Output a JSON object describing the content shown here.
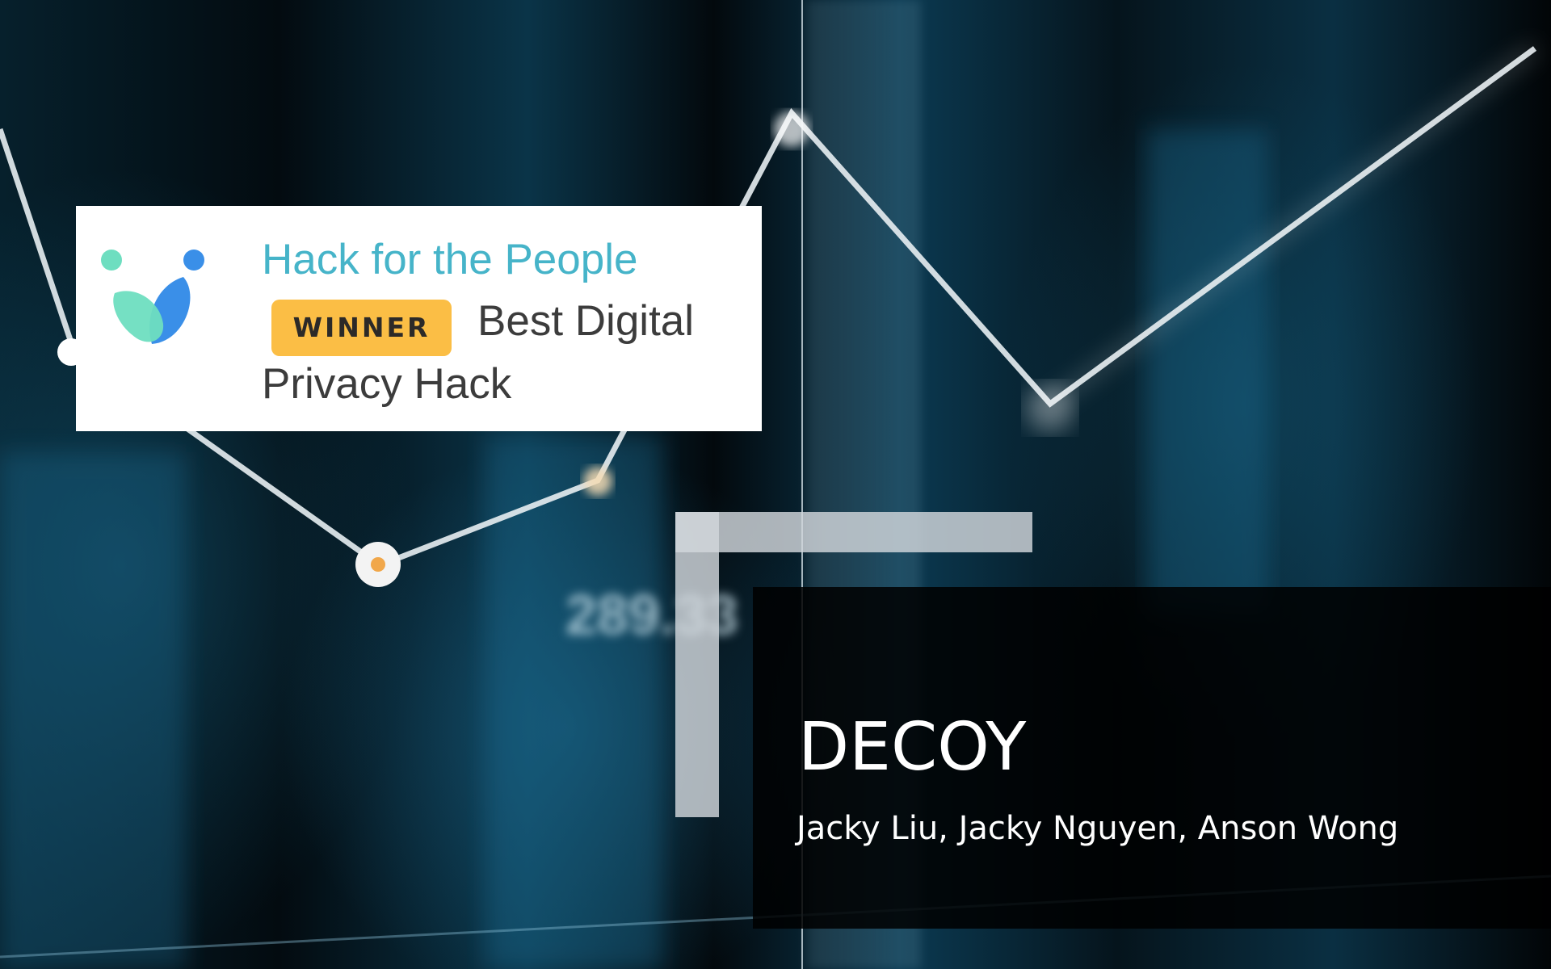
{
  "award": {
    "event": "Hack for the People",
    "badge": "WINNER",
    "prize_part1": "Best Digital",
    "prize_part2": "Privacy Hack",
    "logo_icon": "hack-for-the-people-logo-icon",
    "colors": {
      "event_text": "#46b4c9",
      "badge_bg": "#fbbe45",
      "logo_green": "#6edec0",
      "logo_blue": "#3a8fe8"
    }
  },
  "slide": {
    "title": "DECOY",
    "authors": "Jacky Liu, Jacky Nguyen, Anson Wong"
  },
  "background": {
    "readout": "289.33"
  }
}
